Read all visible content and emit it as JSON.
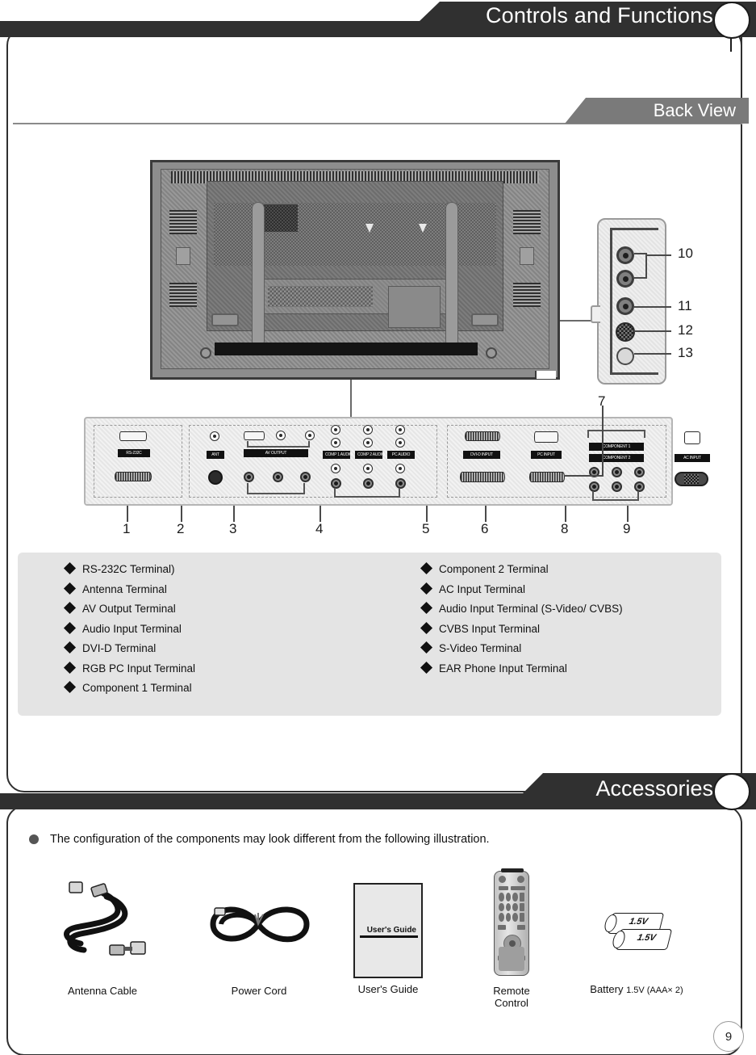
{
  "page": {
    "number": "9"
  },
  "section_controls": {
    "banner_title": "Controls and Functions",
    "subsection_title": "Back View",
    "diagram": {
      "side_panel_callouts": [
        "10",
        "11",
        "12",
        "13"
      ],
      "bottom_callouts": [
        "1",
        "2",
        "3",
        "4",
        "5",
        "6",
        "7",
        "8",
        "9"
      ],
      "terminal_labels": [
        "RS-232C",
        "ANT",
        "AV OUTPUT",
        "COMP 1 AUDIO",
        "COMP 2 AUDIO",
        "PC AUDIO",
        "DVI-D INPUT",
        "PC INPUT",
        "COMPONENT 1",
        "COMPONENT 2",
        "AC INPUT"
      ]
    },
    "legend_left": [
      {
        "bullet": "�",
        "text": "RS-232C Terminal)"
      },
      {
        "bullet": "�",
        "text": "Antenna Terminal"
      },
      {
        "bullet": "�",
        "text": "AV Output Terminal"
      },
      {
        "bullet": "�",
        "text": "Audio Input Terminal"
      },
      {
        "bullet": "�",
        "text": "DVI-D Terminal"
      },
      {
        "bullet": "�",
        "text": "RGB PC Input Terminal"
      },
      {
        "bullet": "�",
        "text": "Component 1 Terminal"
      }
    ],
    "legend_right": [
      {
        "bullet": "�",
        "text": "Component 2 Terminal"
      },
      {
        "bullet": "�",
        "text": "AC Input Terminal"
      },
      {
        "bullet": "�",
        "text": "Audio Input Terminal (S-Video/ CVBS)"
      },
      {
        "bullet": "�",
        "text": "CVBS Input Terminal"
      },
      {
        "bullet": "�",
        "text": "S-Video Terminal"
      },
      {
        "bullet": "�",
        "text": "EAR Phone Input Terminal"
      }
    ]
  },
  "section_accessories": {
    "banner_title": "Accessories",
    "note": "The configuration of the components may look different from the following illustration.",
    "items": [
      {
        "label": "Antenna Cable",
        "label2": ""
      },
      {
        "label": "Power Cord",
        "label2": ""
      },
      {
        "label": "User's Guide",
        "label2": "",
        "cover_text": "User's Guide"
      },
      {
        "label": "Remote",
        "label2": "Control"
      },
      {
        "label": "Battery ",
        "label2": "1.5V (AAA× 2)",
        "batt_text_1": "1.5V",
        "batt_text_2": "1.5V"
      }
    ]
  },
  "colors": {
    "banner_dark": "#303030",
    "banner_gray": "#7a7a7a",
    "legend_bg": "#e4e4e4",
    "frame_border": "#2f2f2f"
  }
}
